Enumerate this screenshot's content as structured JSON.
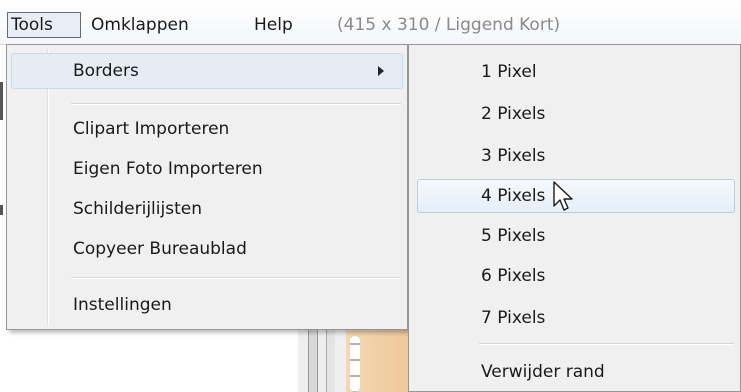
{
  "menubar": {
    "tools": "Tools",
    "omklappen": "Omklappen",
    "help": "Help",
    "info": "(415 x 310 / Liggend Kort)"
  },
  "tools_menu": {
    "borders": "Borders",
    "clipart": "Clipart Importeren",
    "eigen_foto": "Eigen Foto Importeren",
    "schilderijlijsten": "Schilderijlijsten",
    "copyeer": "Copyeer Bureaublad",
    "instellingen": "Instellingen"
  },
  "borders_submenu": {
    "items": [
      "1 Pixel",
      "2 Pixels",
      "3 Pixels",
      "4 Pixels",
      "5 Pixels",
      "6 Pixels",
      "7 Pixels"
    ],
    "remove": "Verwijder rand",
    "hovered": "4 Pixels"
  },
  "icons": {
    "submenu_arrow": "chevron-right-icon",
    "cursor": "mouse-pointer-icon"
  }
}
